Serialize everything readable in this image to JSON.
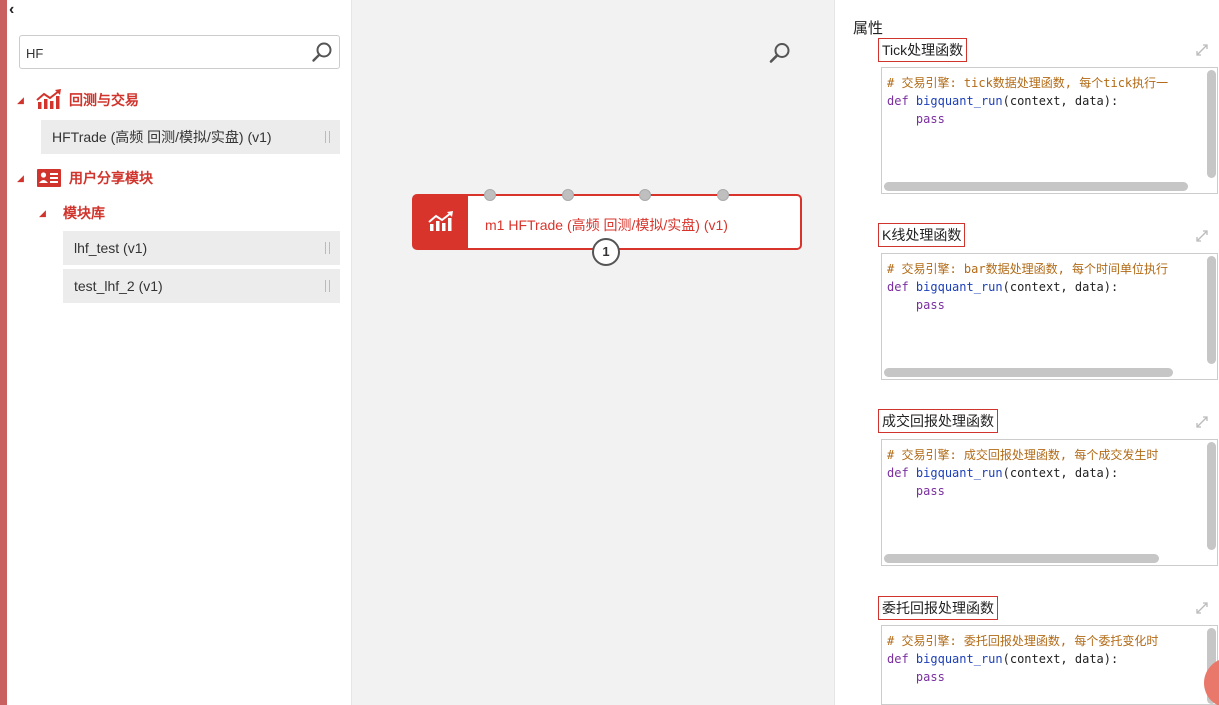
{
  "left": {
    "search": {
      "value": "HF"
    },
    "categories": [
      {
        "label": "回测与交易",
        "items": [
          {
            "label": "HFTrade (高频 回测/模拟/实盘) (v1)"
          }
        ]
      },
      {
        "label": "用户分享模块",
        "subcategory": {
          "label": "模块库",
          "items": [
            {
              "label": "lhf_test (v1)"
            },
            {
              "label": "test_lhf_2 (v1)"
            }
          ]
        }
      }
    ]
  },
  "canvas": {
    "node": {
      "title": "m1 HFTrade (高频 回测/模拟/实盘) (v1)",
      "output_port": "1"
    }
  },
  "properties": {
    "title": "属性",
    "fields": [
      {
        "label": "Tick处理函数",
        "comment": "# 交易引擎: tick数据处理函数, 每个tick执行一",
        "def": "def",
        "fn": "bigquant_run",
        "args": "(context, data):",
        "body": "pass"
      },
      {
        "label": "K线处理函数",
        "comment": "# 交易引擎: bar数据处理函数, 每个时间单位执行",
        "def": "def",
        "fn": "bigquant_run",
        "args": "(context, data):",
        "body": "pass"
      },
      {
        "label": "成交回报处理函数",
        "comment": "# 交易引擎: 成交回报处理函数, 每个成交发生时",
        "def": "def",
        "fn": "bigquant_run",
        "args": "(context, data):",
        "body": "pass"
      },
      {
        "label": "委托回报处理函数",
        "comment": "# 交易引擎: 委托回报处理函数, 每个委托变化时",
        "def": "def",
        "fn": "bigquant_run",
        "args": "(context, data):",
        "body": "pass"
      }
    ]
  },
  "colors": {
    "accent": "#d0342c",
    "sidebar_bar": "#c9605f",
    "canvas_bg": "#f2f2f2"
  }
}
